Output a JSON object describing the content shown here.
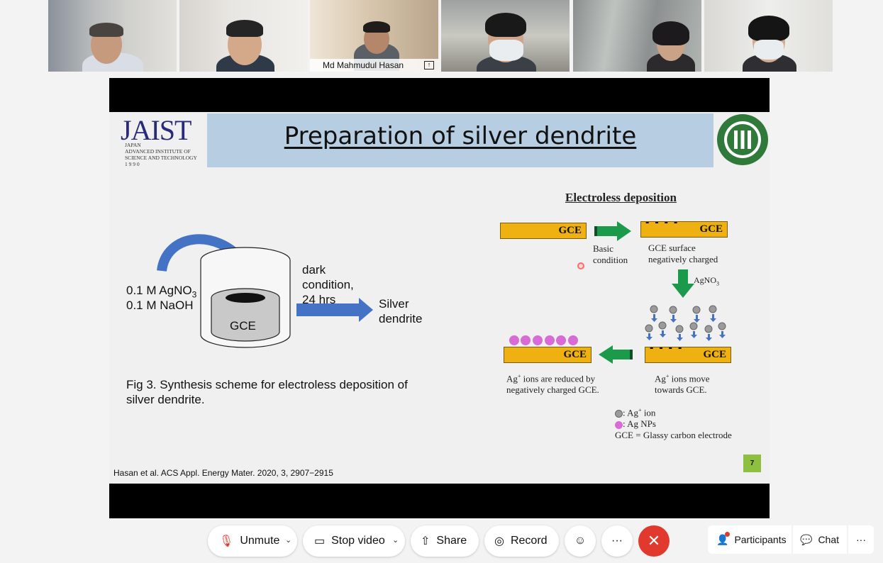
{
  "participants": [
    {
      "name": ""
    },
    {
      "name": ""
    },
    {
      "name": "Md Mahmudul Hasan",
      "active": true
    },
    {
      "name": ""
    },
    {
      "name": ""
    },
    {
      "name": ""
    }
  ],
  "slide": {
    "title": "Preparation of silver dendrite",
    "logo": {
      "main": "JAIST",
      "sub1": "JAPAN",
      "sub2": "ADVANCED INSTITUTE OF",
      "sub3": "SCIENCE AND TECHNOLOGY",
      "sub4": "1 9 9 0"
    },
    "left": {
      "reagent1_prefix": "0.1 M AgNO",
      "reagent1_sub": "3",
      "reagent2": "0.1 M NaOH",
      "vessel_label": "GCE",
      "condition_l1": "dark",
      "condition_l2": "condition,",
      "condition_l3": "24 hrs",
      "product_l1": "Silver",
      "product_l2": "dendrite",
      "caption_l1": "Fig 3. Synthesis scheme for electroless deposition of",
      "caption_l2": "silver dendrite."
    },
    "right": {
      "heading": "Electroless deposition",
      "gce": "GCE",
      "basic_l1": "Basic",
      "basic_l2": "condition",
      "surface_l1": "GCE surface",
      "surface_l2": "negatively charged",
      "agno3_prefix": "AgNO",
      "agno3_sub": "3",
      "reduced_l1_suffix": " ions are reduced by",
      "reduced_l2": "negatively charged GCE.",
      "move_l1_suffix": " ions move",
      "move_l2": "towards GCE.",
      "ag": "Ag",
      "plus": "+",
      "legend1": ": Ag",
      "legend1_suffix": " ion",
      "legend2": ": Ag NPs",
      "legend3": "GCE = Glassy carbon electrode"
    },
    "page_number": "7",
    "citation": "Hasan et al. ACS Appl. Energy Mater. 2020, 3, 2907−2915"
  },
  "toolbar": {
    "unmute": "Unmute",
    "stop_video": "Stop video",
    "share": "Share",
    "record": "Record",
    "more": "···",
    "participants": "Participants",
    "chat": "Chat",
    "overflow": "···"
  },
  "colors": {
    "accent": "#14b5ec",
    "end_call": "#e1392d",
    "gce": "#efb111",
    "arrow_blue": "#4472c4",
    "arrow_green": "#1a9a4a",
    "np_purple": "#d96bd6"
  }
}
